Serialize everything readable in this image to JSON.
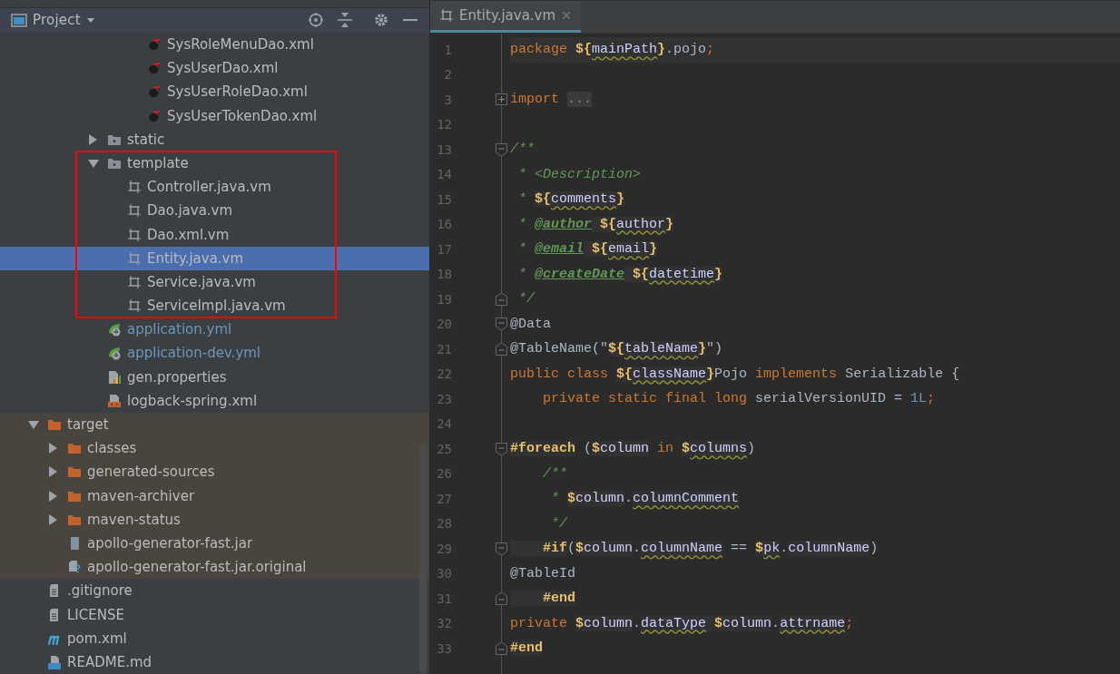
{
  "project_panel": {
    "title": "Project",
    "tree": {
      "items": [
        {
          "children": [
            {
              "children": [
                {
                  "children": [
                    {
                      "children": [
                        {
                          "children": [
                            {
                              "label": "SysRoleMenuDao.xml",
                              "kind": "mybatis",
                              "selected": false,
                              "excluded": false,
                              "changed": false,
                              "boxed": false
                            },
                            {
                              "label": "SysUserDao.xml",
                              "kind": "mybatis",
                              "selected": false,
                              "excluded": false,
                              "changed": false,
                              "boxed": false
                            },
                            {
                              "label": "SysUserRoleDao.xml",
                              "kind": "mybatis",
                              "selected": false,
                              "excluded": false,
                              "changed": false,
                              "boxed": false
                            },
                            {
                              "label": "SysUserTokenDao.xml",
                              "kind": "mybatis",
                              "selected": false,
                              "excluded": false,
                              "changed": false,
                              "boxed": false
                            }
                          ]
                        }
                      ]
                    },
                    {
                      "label": "static",
                      "kind": "folder",
                      "expanded": false,
                      "selected": false,
                      "excluded": false,
                      "changed": false,
                      "boxed": false
                    },
                    {
                      "label": "template",
                      "kind": "folder",
                      "expanded": true,
                      "selected": false,
                      "excluded": false,
                      "changed": false,
                      "boxed": true,
                      "children": [
                        {
                          "label": "Controller.java.vm",
                          "kind": "template",
                          "selected": false,
                          "excluded": false,
                          "changed": false,
                          "boxed": false
                        },
                        {
                          "label": "Dao.java.vm",
                          "kind": "template",
                          "selected": false,
                          "excluded": false,
                          "changed": false,
                          "boxed": false
                        },
                        {
                          "label": "Dao.xml.vm",
                          "kind": "template",
                          "selected": false,
                          "excluded": false,
                          "changed": false,
                          "boxed": false
                        },
                        {
                          "label": "Entity.java.vm",
                          "kind": "template",
                          "selected": true,
                          "excluded": false,
                          "changed": false,
                          "boxed": false
                        },
                        {
                          "label": "Service.java.vm",
                          "kind": "template",
                          "selected": false,
                          "excluded": false,
                          "changed": false,
                          "boxed": false
                        },
                        {
                          "label": "ServiceImpl.java.vm",
                          "kind": "template",
                          "selected": false,
                          "excluded": false,
                          "changed": false,
                          "boxed": false
                        }
                      ]
                    },
                    {
                      "label": "application.yml",
                      "kind": "spring",
                      "selected": false,
                      "excluded": false,
                      "changed": true,
                      "boxed": false
                    },
                    {
                      "label": "application-dev.yml",
                      "kind": "spring",
                      "selected": false,
                      "excluded": false,
                      "changed": true,
                      "boxed": false
                    },
                    {
                      "label": "gen.properties",
                      "kind": "properties",
                      "selected": false,
                      "excluded": false,
                      "changed": false,
                      "boxed": false
                    },
                    {
                      "label": "logback-spring.xml",
                      "kind": "xml",
                      "selected": false,
                      "excluded": false,
                      "changed": false,
                      "boxed": false
                    }
                  ]
                }
              ]
            }
          ]
        },
        {
          "label": "target",
          "kind": "folder",
          "expanded": true,
          "selected": false,
          "excluded": true,
          "changed": false,
          "boxed": false,
          "children": [
            {
              "label": "classes",
              "kind": "folder",
              "expanded": false,
              "selected": false,
              "excluded": true,
              "changed": false,
              "boxed": false
            },
            {
              "label": "generated-sources",
              "kind": "folder",
              "expanded": false,
              "selected": false,
              "excluded": true,
              "changed": false,
              "boxed": false
            },
            {
              "label": "maven-archiver",
              "kind": "folder",
              "expanded": false,
              "selected": false,
              "excluded": true,
              "changed": false,
              "boxed": false
            },
            {
              "label": "maven-status",
              "kind": "folder",
              "expanded": false,
              "selected": false,
              "excluded": true,
              "changed": false,
              "boxed": false
            },
            {
              "label": "apollo-generator-fast.jar",
              "kind": "jar",
              "selected": false,
              "excluded": true,
              "changed": false,
              "boxed": false
            },
            {
              "label": "apollo-generator-fast.jar.original",
              "kind": "unknown",
              "selected": false,
              "excluded": true,
              "changed": false,
              "boxed": false
            }
          ]
        },
        {
          "label": ".gitignore",
          "kind": "text",
          "selected": false,
          "excluded": false,
          "changed": false,
          "boxed": false
        },
        {
          "label": "LICENSE",
          "kind": "text",
          "selected": false,
          "excluded": false,
          "changed": false,
          "boxed": false
        },
        {
          "label": "pom.xml",
          "kind": "maven",
          "selected": false,
          "excluded": false,
          "changed": false,
          "boxed": false
        },
        {
          "label": "README.md",
          "kind": "markdown",
          "selected": false,
          "excluded": false,
          "changed": false,
          "boxed": false
        }
      ]
    }
  },
  "editor": {
    "tabs": [
      {
        "label": "Entity.java.vm",
        "selected": true
      }
    ],
    "lines": [
      {
        "number": "1",
        "kind": "plain",
        "current": true,
        "tokens": [
          {
            "text": "package ",
            "kind": "kw"
          },
          {
            "text": "${",
            "kind": "vtl"
          },
          {
            "text": "mainPath",
            "kind": "ref"
          },
          {
            "text": "}",
            "kind": "vtl"
          },
          {
            "text": ".pojo",
            "kind": "plain"
          },
          {
            "text": ";",
            "kind": "kw"
          }
        ]
      },
      {
        "number": "2",
        "kind": "plain",
        "current": false
      },
      {
        "number": "3",
        "kind": "folded",
        "current": false,
        "tokens": [
          {
            "text": "import ",
            "kind": "kw"
          },
          {
            "text": "...",
            "kind": "folded"
          }
        ]
      },
      {
        "number": "12",
        "kind": "plain",
        "current": false
      },
      {
        "number": "13",
        "kind": "fold-start",
        "current": false,
        "tokens": [
          {
            "text": "/**",
            "kind": "doc"
          }
        ]
      },
      {
        "number": "14",
        "kind": "plain",
        "current": false,
        "tokens": [
          {
            "text": " * <Description>",
            "kind": "doc"
          }
        ]
      },
      {
        "number": "15",
        "kind": "plain",
        "current": false,
        "tokens": [
          {
            "text": " * ",
            "kind": "doc"
          },
          {
            "text": "${",
            "kind": "vtl"
          },
          {
            "text": "comments",
            "kind": "ref"
          },
          {
            "text": "}",
            "kind": "vtl"
          }
        ]
      },
      {
        "number": "16",
        "kind": "plain",
        "current": false,
        "tokens": [
          {
            "text": " * ",
            "kind": "doc"
          },
          {
            "text": "@author",
            "kind": "doctag"
          },
          {
            "text": " ${",
            "kind": "vtl"
          },
          {
            "text": "author",
            "kind": "ref"
          },
          {
            "text": "}",
            "kind": "vtl"
          }
        ]
      },
      {
        "number": "17",
        "kind": "plain",
        "current": false,
        "tokens": [
          {
            "text": " * ",
            "kind": "doc"
          },
          {
            "text": "@email",
            "kind": "doctag"
          },
          {
            "text": " ${",
            "kind": "vtl"
          },
          {
            "text": "email",
            "kind": "ref"
          },
          {
            "text": "}",
            "kind": "vtl"
          }
        ]
      },
      {
        "number": "18",
        "kind": "plain",
        "current": false,
        "tokens": [
          {
            "text": " * ",
            "kind": "doc"
          },
          {
            "text": "@createDate",
            "kind": "doctag"
          },
          {
            "text": " ${",
            "kind": "vtl"
          },
          {
            "text": "datetime",
            "kind": "ref"
          },
          {
            "text": "}",
            "kind": "vtl"
          }
        ]
      },
      {
        "number": "19",
        "kind": "fold-end",
        "current": false,
        "tokens": [
          {
            "text": " */",
            "kind": "doc"
          }
        ]
      },
      {
        "number": "20",
        "kind": "fold-start",
        "current": false,
        "tokens": [
          {
            "text": "@Data",
            "kind": "plain"
          }
        ]
      },
      {
        "number": "21",
        "kind": "fold-end",
        "current": false,
        "tokens": [
          {
            "text": "@TableName(\"",
            "kind": "plain"
          },
          {
            "text": "${",
            "kind": "vtl"
          },
          {
            "text": "tableName",
            "kind": "ref"
          },
          {
            "text": "}",
            "kind": "vtl"
          },
          {
            "text": "\")",
            "kind": "plain"
          }
        ]
      },
      {
        "number": "22",
        "kind": "plain",
        "current": false,
        "tokens": [
          {
            "text": "public class ",
            "kind": "kw"
          },
          {
            "text": "${",
            "kind": "vtl"
          },
          {
            "text": "className",
            "kind": "ref"
          },
          {
            "text": "}",
            "kind": "vtl"
          },
          {
            "text": "Pojo ",
            "kind": "plain"
          },
          {
            "text": "implements ",
            "kind": "kw"
          },
          {
            "text": "Serializable {",
            "kind": "plain"
          }
        ]
      },
      {
        "number": "23",
        "kind": "plain",
        "current": false,
        "tokens": [
          {
            "text": "    private static final long ",
            "kind": "kw"
          },
          {
            "text": "serialVersionUID = ",
            "kind": "plain"
          },
          {
            "text": "1L",
            "kind": "num"
          },
          {
            "text": ";",
            "kind": "kw"
          }
        ]
      },
      {
        "number": "24",
        "kind": "plain",
        "current": false
      },
      {
        "number": "25",
        "kind": "fold-start",
        "current": false,
        "tokens": [
          {
            "text": "#foreach",
            "kind": "dir"
          },
          {
            "text": " (",
            "kind": "plain"
          },
          {
            "text": "$",
            "kind": "vtl"
          },
          {
            "text": "column",
            "kind": "name"
          },
          {
            "text": " in ",
            "kind": "kw"
          },
          {
            "text": "$",
            "kind": "vtl"
          },
          {
            "text": "columns",
            "kind": "ref"
          },
          {
            "text": ")",
            "kind": "plain"
          }
        ]
      },
      {
        "number": "26",
        "kind": "plain",
        "current": false,
        "tokens": [
          {
            "text": "    /**",
            "kind": "doc"
          }
        ]
      },
      {
        "number": "27",
        "kind": "plain",
        "current": false,
        "tokens": [
          {
            "text": "     * ",
            "kind": "doc"
          },
          {
            "text": "$",
            "kind": "vtl"
          },
          {
            "text": "column",
            "kind": "name"
          },
          {
            "text": ".",
            "kind": "plain"
          },
          {
            "text": "columnComment",
            "kind": "ref"
          }
        ]
      },
      {
        "number": "28",
        "kind": "plain",
        "current": false,
        "tokens": [
          {
            "text": "     */",
            "kind": "doc"
          }
        ]
      },
      {
        "number": "29",
        "kind": "fold-start",
        "current": false,
        "tokens": [
          {
            "text": "    #if",
            "kind": "dir"
          },
          {
            "text": "(",
            "kind": "plain"
          },
          {
            "text": "$",
            "kind": "vtl"
          },
          {
            "text": "column",
            "kind": "name"
          },
          {
            "text": ".",
            "kind": "plain"
          },
          {
            "text": "columnName",
            "kind": "ref"
          },
          {
            "text": " == ",
            "kind": "plain"
          },
          {
            "text": "$",
            "kind": "vtl"
          },
          {
            "text": "pk",
            "kind": "ref"
          },
          {
            "text": ".",
            "kind": "plain"
          },
          {
            "text": "columnName",
            "kind": "name"
          },
          {
            "text": ")",
            "kind": "plain"
          }
        ]
      },
      {
        "number": "30",
        "kind": "plain",
        "current": false,
        "tokens": [
          {
            "text": "@TableId",
            "kind": "plain"
          }
        ]
      },
      {
        "number": "31",
        "kind": "fold-end",
        "current": false,
        "tokens": [
          {
            "text": "    #end",
            "kind": "dir"
          }
        ]
      },
      {
        "number": "32",
        "kind": "plain",
        "current": false,
        "tokens": [
          {
            "text": "private ",
            "kind": "kw"
          },
          {
            "text": "$",
            "kind": "vtl"
          },
          {
            "text": "column",
            "kind": "name"
          },
          {
            "text": ".",
            "kind": "plain"
          },
          {
            "text": "dataType",
            "kind": "ref"
          },
          {
            "text": " $",
            "kind": "vtl"
          },
          {
            "text": "column",
            "kind": "name"
          },
          {
            "text": ".",
            "kind": "plain"
          },
          {
            "text": "attrname",
            "kind": "ref"
          },
          {
            "text": ";",
            "kind": "kw"
          }
        ]
      },
      {
        "number": "33",
        "kind": "fold-end",
        "current": false,
        "tokens": [
          {
            "text": "#end",
            "kind": "dir"
          }
        ]
      }
    ]
  }
}
